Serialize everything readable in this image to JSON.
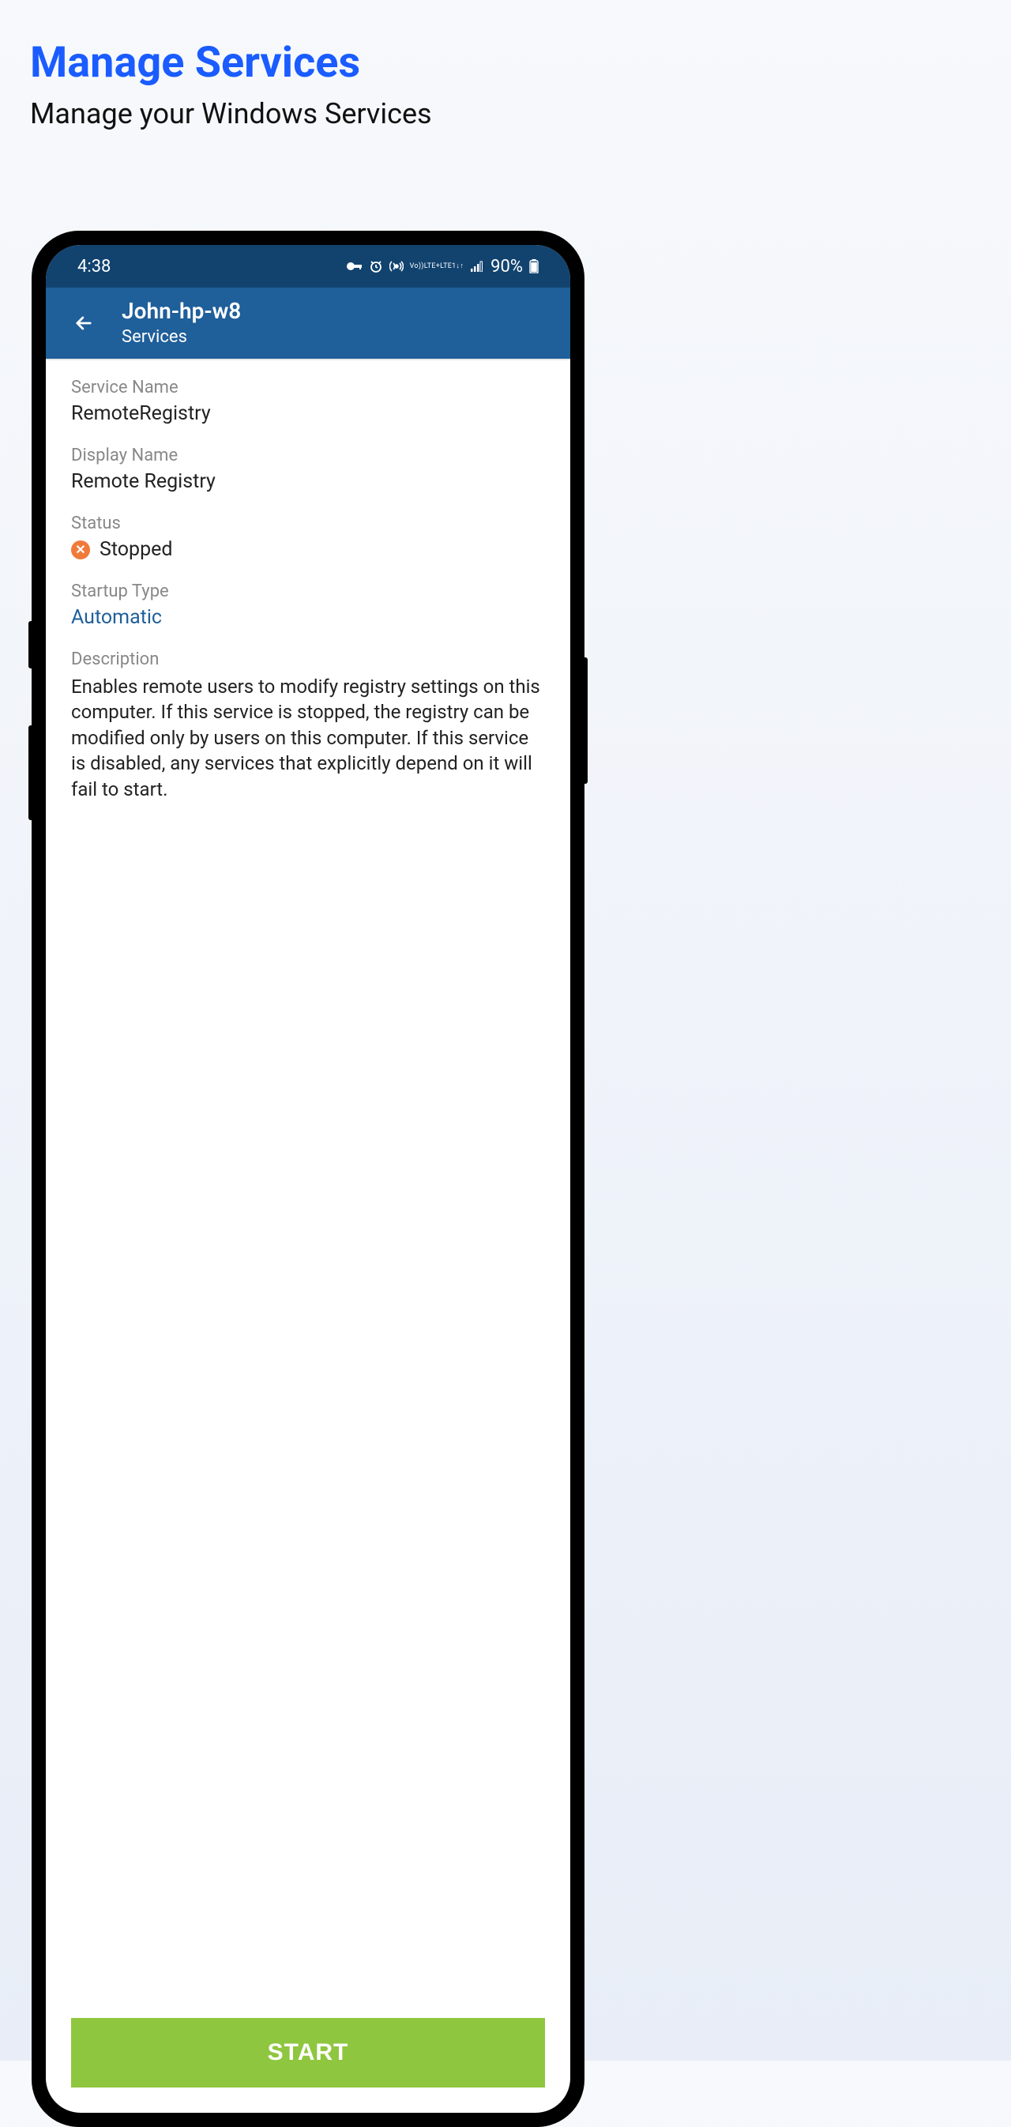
{
  "page": {
    "title": "Manage Services",
    "subtitle": "Manage your Windows Services"
  },
  "status_bar": {
    "time": "4:38",
    "battery": "90%",
    "network_label": "LTE1",
    "network_label2": "LTE+",
    "vo_label": "Vo))"
  },
  "app_bar": {
    "title": "John-hp-w8",
    "subtitle": "Services"
  },
  "fields": {
    "service_name": {
      "label": "Service Name",
      "value": "RemoteRegistry"
    },
    "display_name": {
      "label": "Display Name",
      "value": "Remote Registry"
    },
    "status": {
      "label": "Status",
      "value": "Stopped",
      "status_icon": "stopped"
    },
    "startup_type": {
      "label": "Startup Type",
      "value": "Automatic"
    },
    "description": {
      "label": "Description",
      "value": "Enables remote users to modify registry settings on this computer. If this service is stopped, the registry can be modified only by users on this computer. If this service is disabled, any services that explicitly depend on it will fail to start."
    }
  },
  "buttons": {
    "start": "START"
  }
}
